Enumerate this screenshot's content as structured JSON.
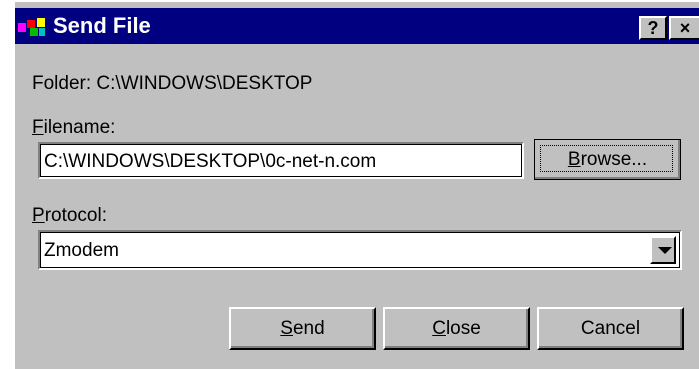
{
  "window": {
    "title": "Send File",
    "help_button": "?",
    "close_button": "×"
  },
  "folder": {
    "label": "Folder:",
    "value": "C:\\WINDOWS\\DESKTOP"
  },
  "filename": {
    "label_accel": "F",
    "label_rest": "ilename:",
    "value": "C:\\WINDOWS\\DESKTOP\\0c-net-n.com",
    "browse_accel": "B",
    "browse_rest": "rowse..."
  },
  "protocol": {
    "label_accel": "P",
    "label_rest": "rotocol:",
    "selected": "Zmodem"
  },
  "buttons": {
    "send_accel": "S",
    "send_rest": "end",
    "close_accel": "C",
    "close_rest": "lose",
    "cancel": "Cancel"
  }
}
